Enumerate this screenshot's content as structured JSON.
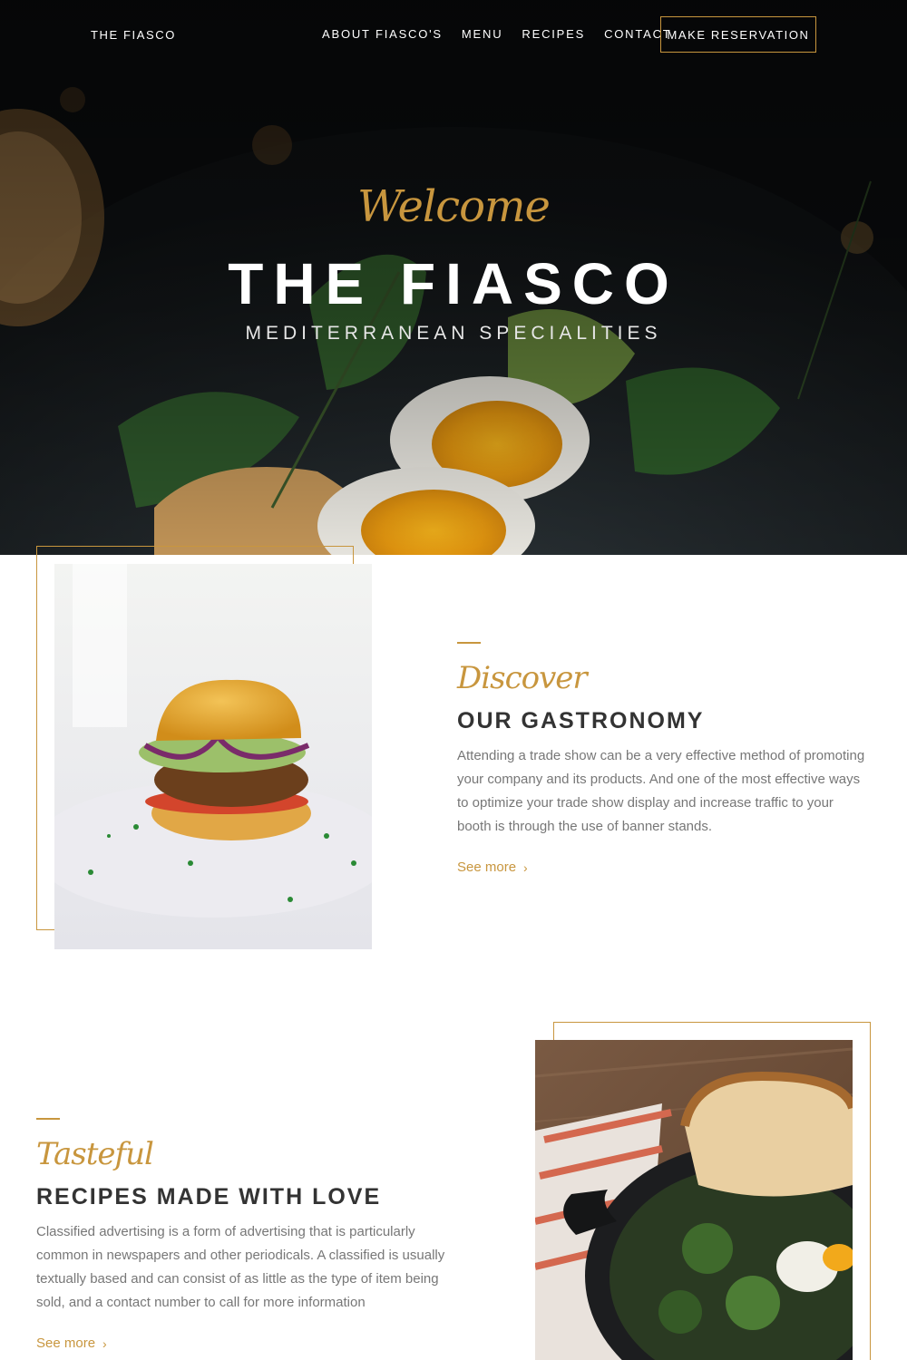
{
  "nav": {
    "brand": "THE FIASCO",
    "links": [
      "ABOUT FIASCO'S",
      "MENU",
      "RECIPES",
      "CONTACT"
    ],
    "reservation": "MAKE RESERVATION"
  },
  "hero": {
    "welcome": "Welcome",
    "title": "THE FIASCO",
    "subtitle": "MEDITERRANEAN SPECIALITIES"
  },
  "gastronomy": {
    "script": "Discover",
    "title": "OUR GASTRONOMY",
    "text": "Attending a trade show can be a very effective method of promoting your company and its products. And one of the most effective ways to optimize your trade show display and increase traffic to your booth is through the use of banner stands.",
    "link": "See more"
  },
  "recipes": {
    "script": "Tasteful",
    "title": "RECIPES MADE WITH LOVE",
    "text": "Classified advertising is a form of advertising that is particularly common in newspapers and other periodicals. A classified is usually textually based and can consist of as little as the type of item being sold, and a contact number to call for more information",
    "link": "See more"
  },
  "colors": {
    "accent": "#c8963e",
    "heading": "#333333",
    "body_text": "#777777"
  },
  "icons": {
    "see_more": "chevron-right-icon"
  }
}
